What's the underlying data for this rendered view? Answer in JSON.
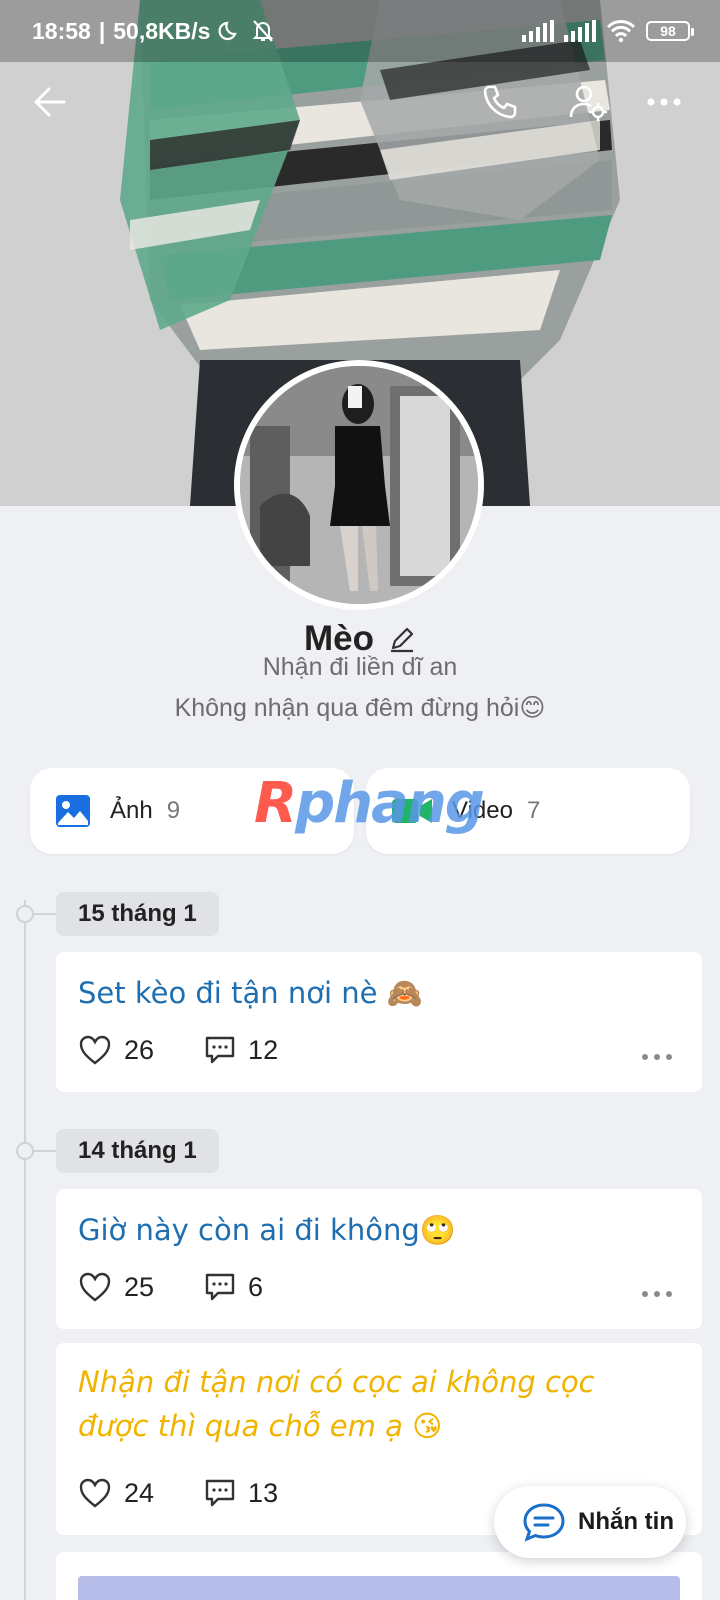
{
  "status_bar": {
    "time": "18:58",
    "speed": "50,8KB/s",
    "battery": "98"
  },
  "nav": {
    "back_icon": "arrow-left-icon",
    "call_icon": "phone-icon",
    "settings_icon": "user-settings-icon",
    "more_icon": "more-horizontal-icon"
  },
  "profile": {
    "name": "Mèo",
    "bio_line1": "Nhận đi liền dĩ an",
    "bio_line2": "Không nhận qua đêm đừng hỏi😊"
  },
  "media": {
    "photos_label": "Ảnh",
    "photos_count": "9",
    "videos_label": "Video",
    "videos_count": "7"
  },
  "watermark": {
    "part1": "R",
    "part2": "phang"
  },
  "timeline": [
    {
      "date": "15 tháng 1",
      "posts": [
        {
          "text": "Set kèo đi tận nơi nè 🙈",
          "likes": "26",
          "comments": "12",
          "color": "#1f6fb0"
        }
      ]
    },
    {
      "date": "14 tháng 1",
      "posts": [
        {
          "text": "Giờ này còn ai đi không🙄",
          "likes": "25",
          "comments": "6",
          "color": "#1f6fb0"
        },
        {
          "text_line1": "Nhận đi tận nơi có cọc ai không cọc",
          "text_line2": "được thì qua chỗ em ạ 😘",
          "likes": "24",
          "comments": "13",
          "color": "#f0b400"
        }
      ]
    }
  ],
  "fab": {
    "label": "Nhắn tin"
  },
  "colors": {
    "accent": "#1f6fb0",
    "highlight": "#f0b400",
    "background": "#eef0f3"
  }
}
